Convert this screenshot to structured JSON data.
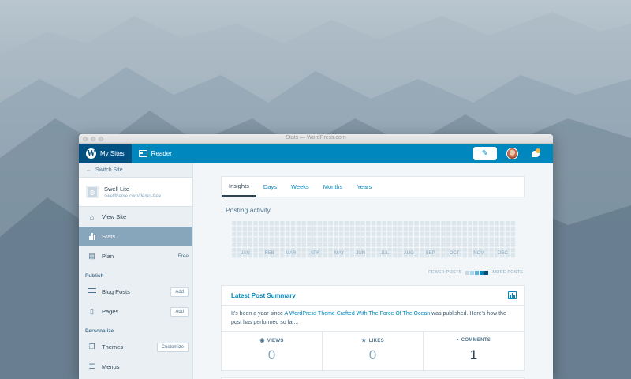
{
  "window": {
    "title": "Stats — WordPress.com"
  },
  "masterbar": {
    "my_sites": "My Sites",
    "reader": "Reader",
    "write_icon": "write-icon",
    "notifications_icon": "bell-icon"
  },
  "sidebar": {
    "switch_site": "Switch Site",
    "site": {
      "name": "Swell Lite",
      "url": "swelltheme.com/demo-free"
    },
    "view_site": "View Site",
    "stats": "Stats",
    "plan": {
      "label": "Plan",
      "badge": "Free"
    },
    "publish_header": "Publish",
    "blog_posts": {
      "label": "Blog Posts",
      "action": "Add"
    },
    "pages": {
      "label": "Pages",
      "action": "Add"
    },
    "personalize_header": "Personalize",
    "themes": {
      "label": "Themes",
      "action": "Customize"
    },
    "menus": "Menus"
  },
  "tabs": [
    "Insights",
    "Days",
    "Weeks",
    "Months",
    "Years"
  ],
  "posting_activity": {
    "title": "Posting activity",
    "months": [
      "JAN",
      "FEB",
      "MAR",
      "APR",
      "MAY",
      "JUN",
      "JUL",
      "AUG",
      "SEP",
      "OCT",
      "NOV",
      "DEC"
    ],
    "legend_fewer": "FEWER POSTS",
    "legend_more": "MORE POSTS",
    "legend_colors": [
      "#c8d7e1",
      "#a8d6ec",
      "#5fb0d8",
      "#0087be",
      "#005082"
    ],
    "empty_color": "#dce6ed"
  },
  "latest_post": {
    "title": "Latest Post Summary",
    "text_before": "It's been a year since ",
    "post_link": "A WordPress Theme Crafted With The Force Of The Ocean",
    "text_after": " was published. Here's how the post has performed so far...",
    "stats": [
      {
        "icon": "eye-icon",
        "glyph": "👁",
        "label": "VIEWS",
        "value": "0"
      },
      {
        "icon": "star-icon",
        "glyph": "★",
        "label": "LIKES",
        "value": "0"
      },
      {
        "icon": "comment-icon",
        "glyph": "■",
        "label": "COMMENTS",
        "value": "1"
      }
    ]
  }
}
